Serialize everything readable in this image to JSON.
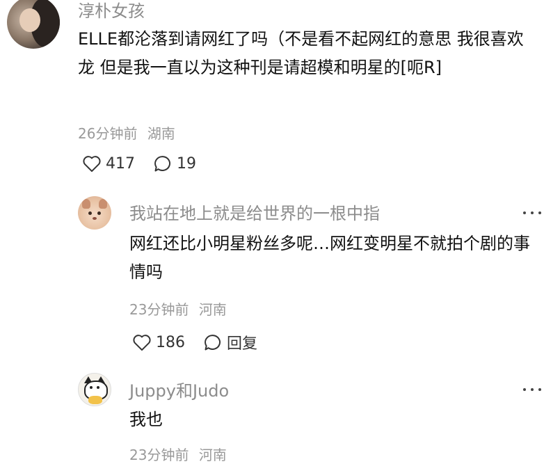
{
  "comments": [
    {
      "username": "淳朴女孩",
      "content": "ELLE都沦落到请网红了吗（不是看不起网红的意思 我很喜欢龙 但是我一直以为这种刊是请超模和明星的[呃R]",
      "time": "26分钟前",
      "location": "湖南",
      "likes": "417",
      "replies": "19"
    },
    {
      "username": "我站在地上就是给世界的一根中指",
      "content": "网红还比小明星粉丝多呢…网红变明星不就拍个剧的事情吗",
      "time": "23分钟前",
      "location": "河南",
      "likes": "186",
      "reply_label": "回复"
    },
    {
      "username": "Juppy和Judo",
      "content": "我也",
      "time": "23分钟前",
      "location": "河南"
    }
  ]
}
